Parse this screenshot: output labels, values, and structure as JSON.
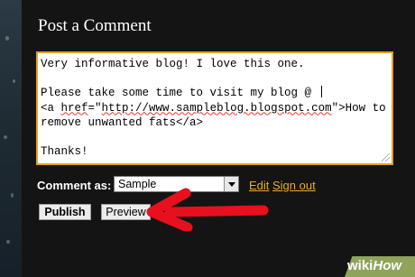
{
  "section": {
    "title": "Post a Comment"
  },
  "comment": {
    "line1": "Very informative blog! I love this one.",
    "line2": "Please take some time to visit my blog @ ",
    "line3_pre": "<a ",
    "line3_href": "href",
    "line3_eq": "=\"",
    "line3_url": "http://www.sampleblog.blogspot.com",
    "line3_post": "\">How to",
    "line4": "remove unwanted fats</a>",
    "line5": "Thanks!"
  },
  "identity": {
    "label": "Comment as:",
    "selected": "Sample",
    "edit_label": "Edit",
    "signout_label": "Sign out"
  },
  "buttons": {
    "publish_label": "Publish",
    "preview_label": "Preview"
  },
  "watermark": {
    "wiki": "wiki",
    "how": "How"
  },
  "colors": {
    "background": "#141414",
    "accent": "#f0a830",
    "arrow": "#e8101c",
    "focus_border": "#e6a020"
  },
  "icons": {
    "arrow": "red-arrow-icon",
    "dropdown": "chevron-down-icon"
  }
}
